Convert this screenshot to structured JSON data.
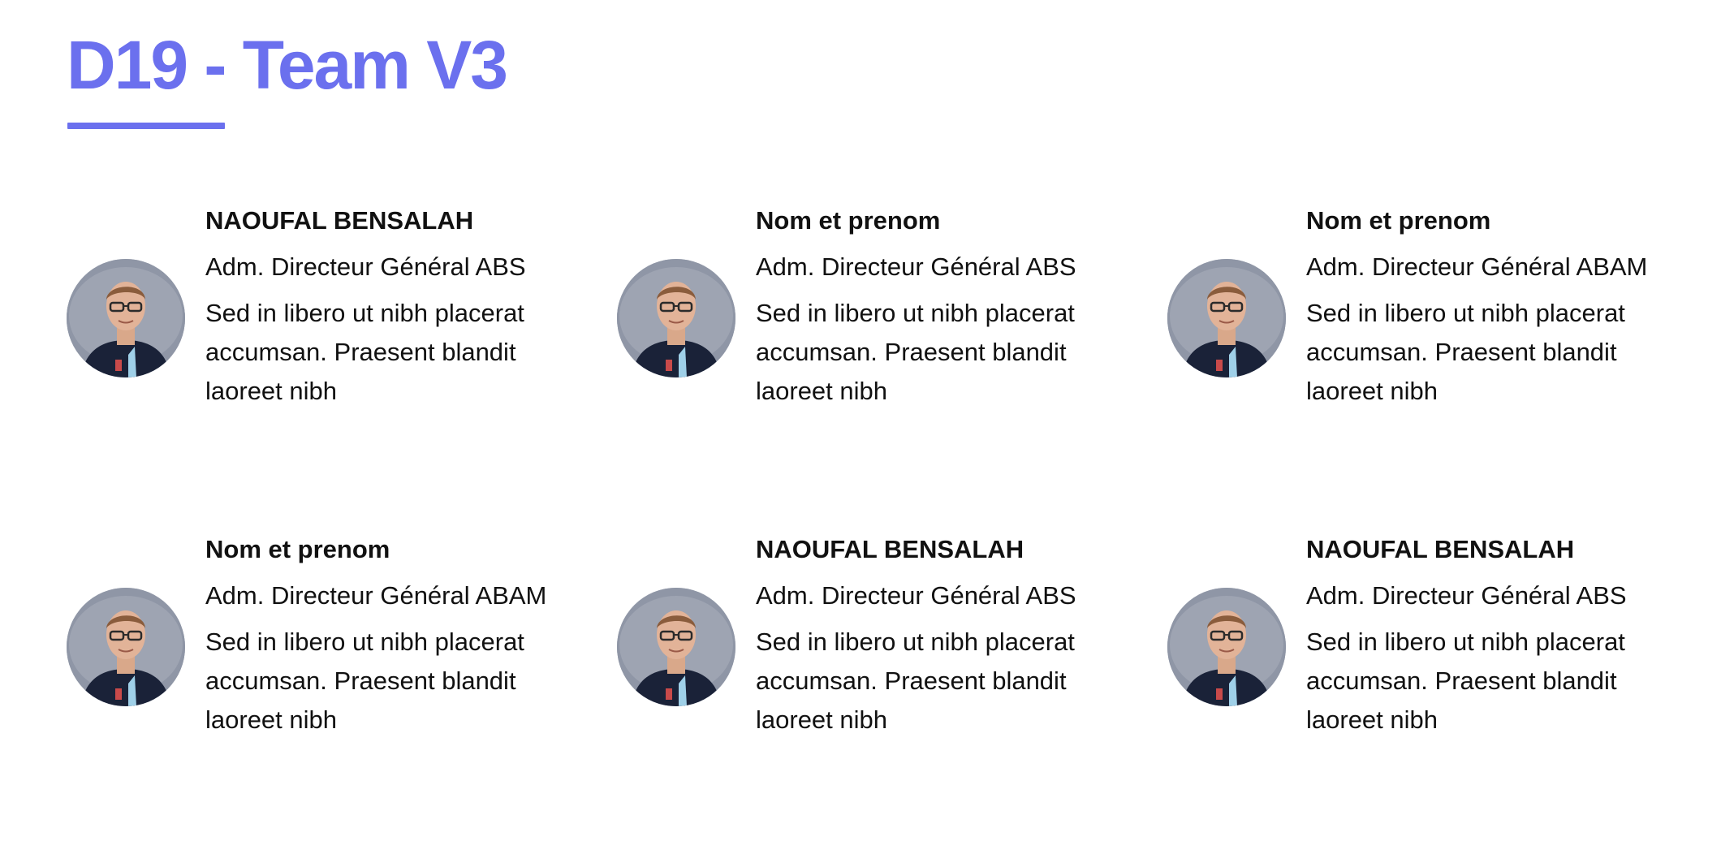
{
  "header": {
    "title": "D19 - Team V3",
    "accent_color": "#6b70ee"
  },
  "team": [
    {
      "name": "NAOUFAL BENSALAH",
      "role": "Adm. Directeur Général ABS",
      "description": "Sed in libero ut nibh placerat accumsan. Praesent blandit laoreet nibh",
      "avatar_icon": "person-photo"
    },
    {
      "name": "Nom et prenom",
      "role": "Adm. Directeur Général ABS",
      "description": "Sed in libero ut nibh placerat accumsan. Praesent blandit laoreet nibh",
      "avatar_icon": "person-photo"
    },
    {
      "name": "Nom et prenom",
      "role": "Adm. Directeur Général ABAM",
      "description": "Sed in libero ut nibh placerat accumsan. Praesent blandit laoreet nibh",
      "avatar_icon": "person-photo"
    },
    {
      "name": "Nom et prenom",
      "role": "Adm. Directeur Général ABAM",
      "description": "Sed in libero ut nibh placerat accumsan. Praesent blandit laoreet nibh",
      "avatar_icon": "person-photo"
    },
    {
      "name": "NAOUFAL BENSALAH",
      "role": "Adm. Directeur Général ABS",
      "description": "Sed in libero ut nibh placerat accumsan. Praesent blandit laoreet nibh",
      "avatar_icon": "person-photo"
    },
    {
      "name": "NAOUFAL BENSALAH",
      "role": "Adm. Directeur Général ABS",
      "description": "Sed in libero ut nibh placerat accumsan. Praesent blandit laoreet nibh",
      "avatar_icon": "person-photo"
    }
  ]
}
